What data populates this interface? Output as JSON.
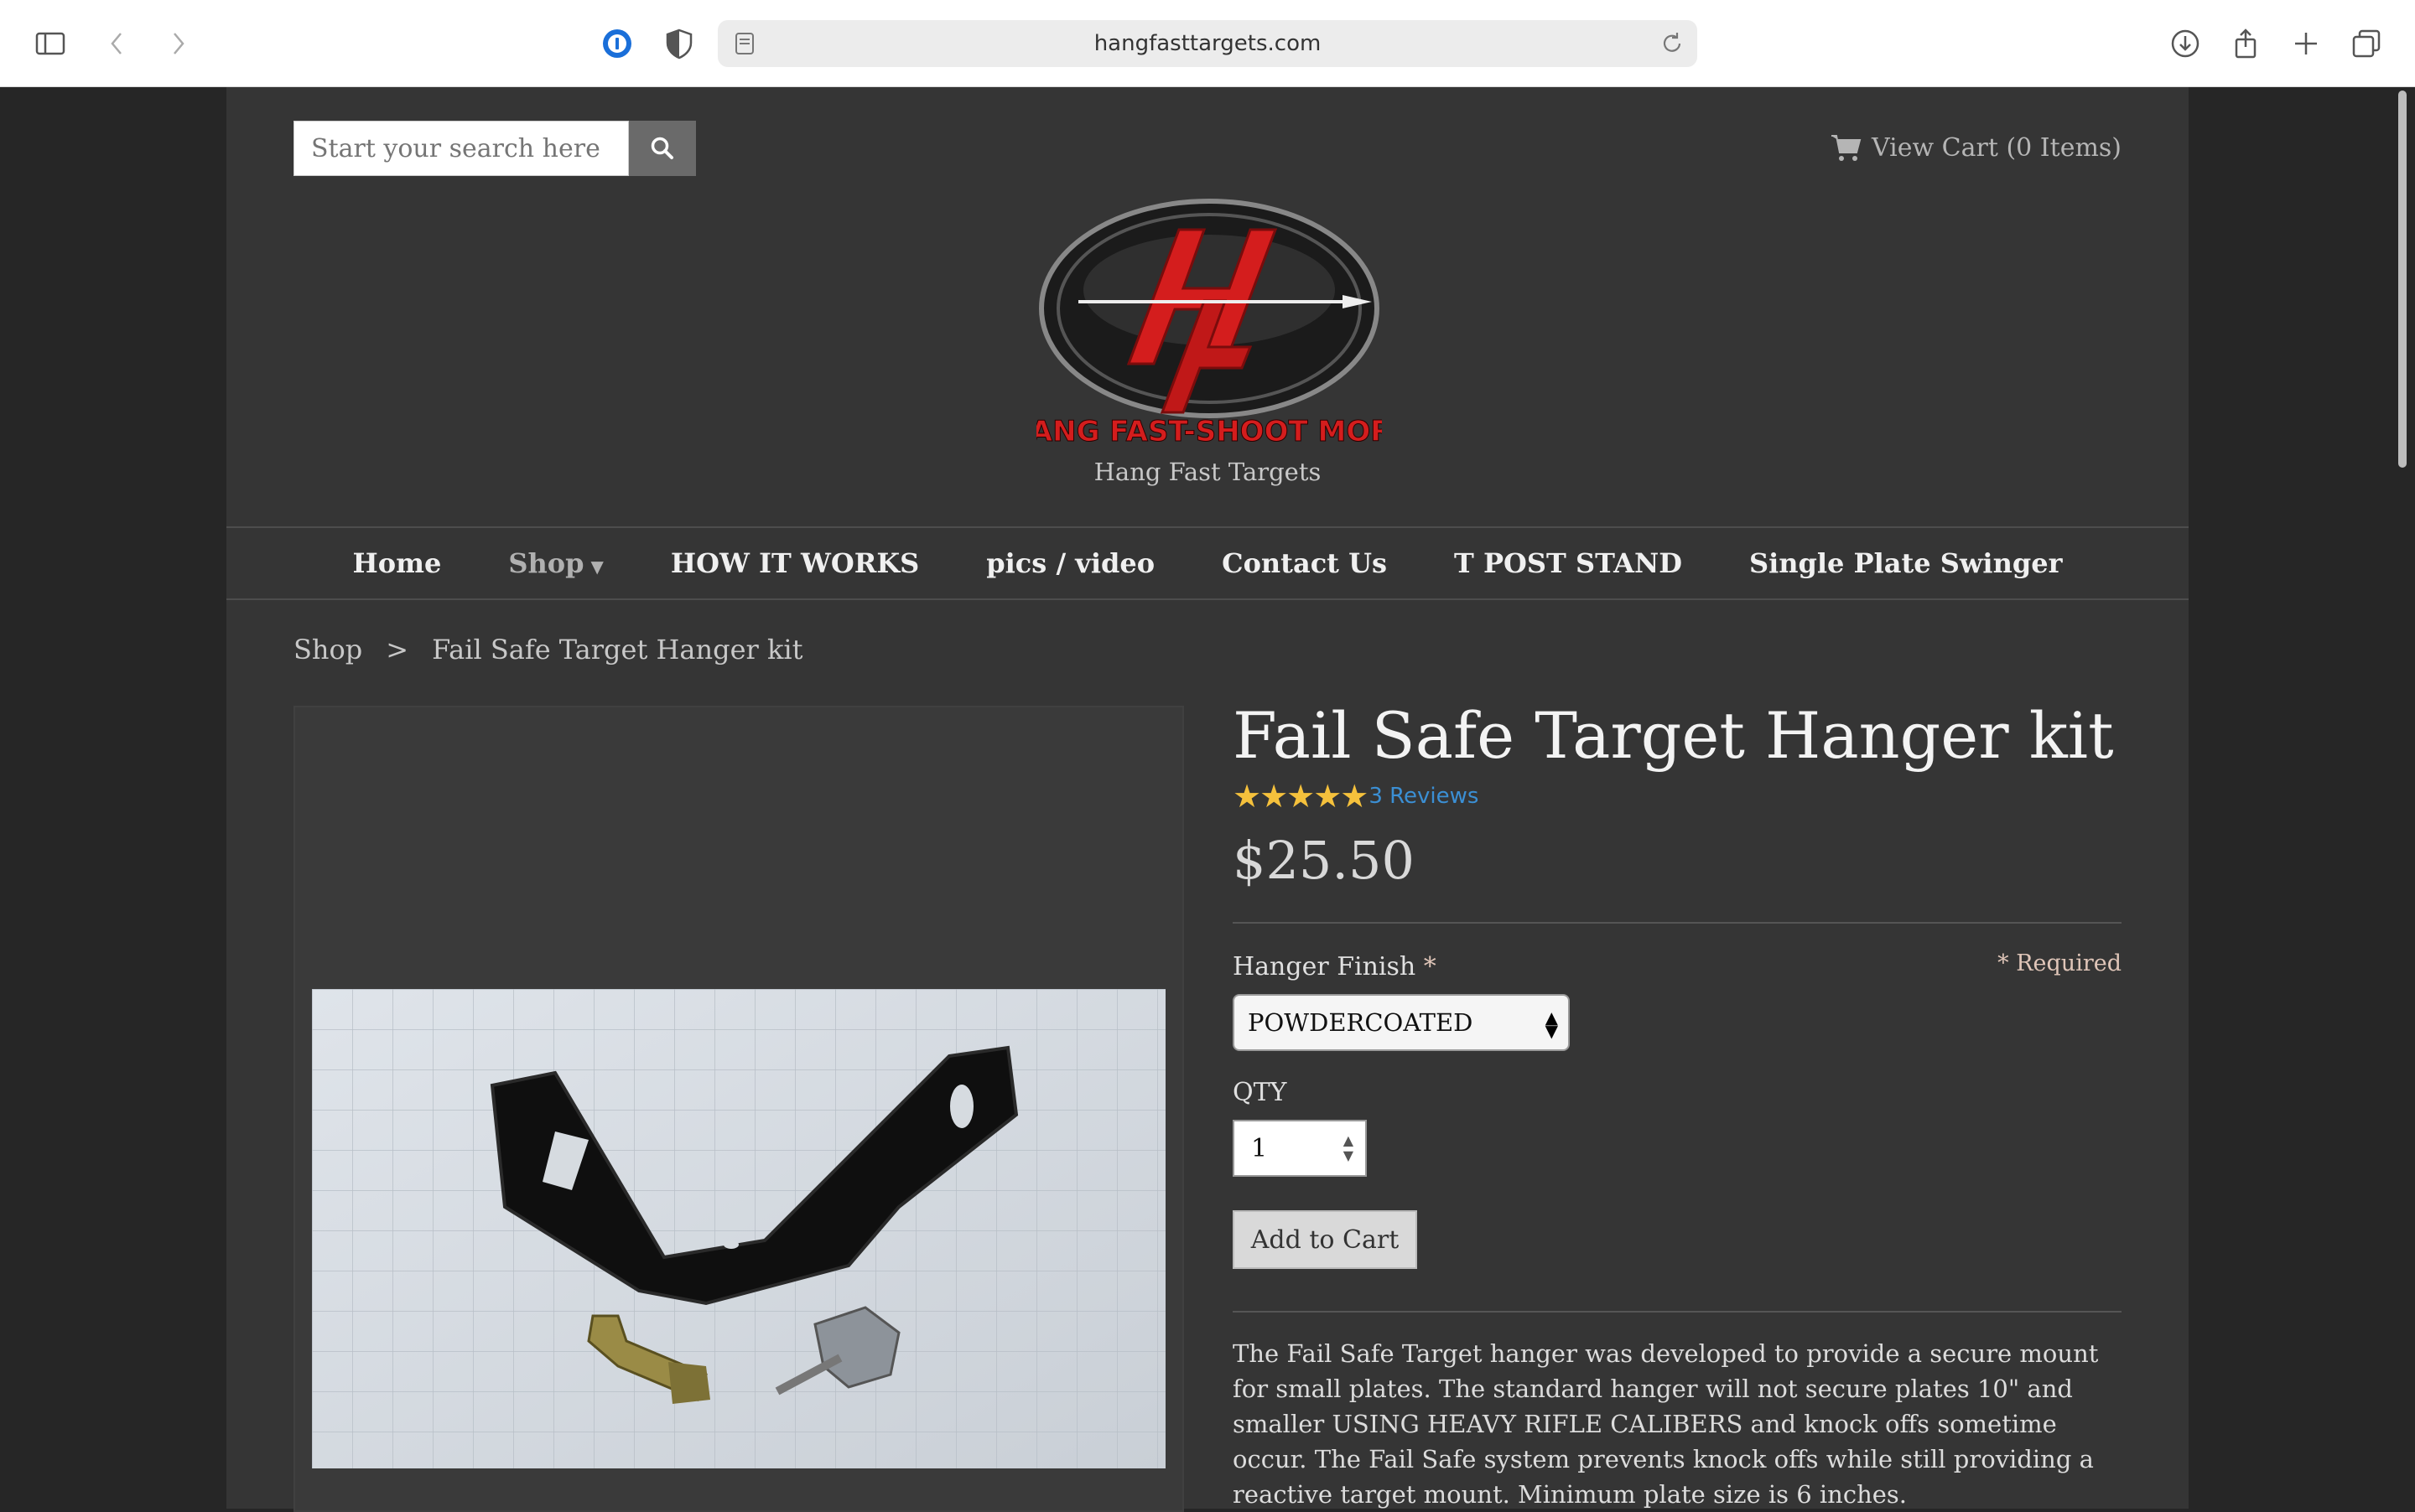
{
  "browser": {
    "url": "hangfasttargets.com"
  },
  "header": {
    "search_placeholder": "Start your search here",
    "cart_label": "View Cart (0 Items)",
    "site_title": "Hang Fast Targets",
    "logo_text": "HANG FAST-SHOOT MORE"
  },
  "nav": {
    "items": [
      {
        "label": "Home"
      },
      {
        "label": "Shop"
      },
      {
        "label": "HOW IT WORKS"
      },
      {
        "label": "pics / video"
      },
      {
        "label": "Contact Us"
      },
      {
        "label": "T POST STAND"
      },
      {
        "label": "Single Plate Swinger"
      }
    ]
  },
  "breadcrumb": {
    "parent": "Shop",
    "separator": ">",
    "current": "Fail Safe Target Hanger kit"
  },
  "product": {
    "title": "Fail Safe Target Hanger kit",
    "stars": "★★★★★",
    "rating": 5,
    "reviews_label": "3 Reviews",
    "price": "$25.50",
    "option_label": "Hanger Finish",
    "option_required_mark": "*",
    "required_note": "* Required",
    "option_value": "POWDERCOATED",
    "qty_label": "QTY",
    "qty_value": "1",
    "add_to_cart": "Add to Cart",
    "description": "The Fail Safe Target hanger was developed to provide a secure mount for small plates.  The standard hanger will not secure plates 10\" and smaller USING HEAVY RIFLE CALIBERS and knock offs sometime occur.    The Fail Safe system prevents knock offs while still providing a reactive target mount.  Minimum plate size is 6 inches."
  },
  "colors": {
    "page_bg": "#353535",
    "outer_bg": "#262626",
    "star": "#f5c13c",
    "link": "#3b8fd4",
    "logo_red": "#d41d1d"
  }
}
